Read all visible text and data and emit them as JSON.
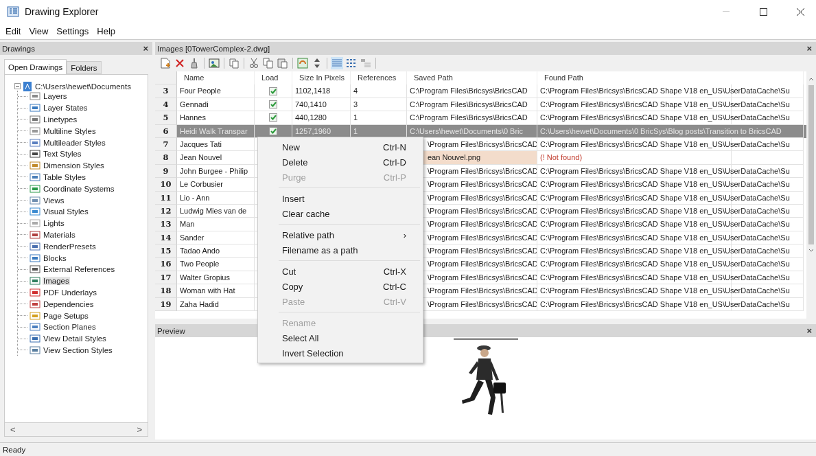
{
  "window": {
    "title": "Drawing Explorer"
  },
  "menubar": [
    "Edit",
    "View",
    "Settings",
    "Help"
  ],
  "drawings_panel": {
    "title": "Drawings",
    "close": "×",
    "tabs": [
      {
        "label": "Open Drawings",
        "selected": true
      },
      {
        "label": "Folders",
        "selected": false
      }
    ],
    "tree": {
      "label": "C:\\Users\\hewet\\Documents",
      "expanded": true,
      "children": [
        {
          "label": "Layers",
          "kind": "layers",
          "selected": false
        },
        {
          "label": "Layer States",
          "kind": "layerstates",
          "selected": false
        },
        {
          "label": "Linetypes",
          "kind": "linetypes",
          "selected": false
        },
        {
          "label": "Multiline Styles",
          "kind": "multiline",
          "selected": false
        },
        {
          "label": "Multileader Styles",
          "kind": "multileader",
          "selected": false
        },
        {
          "label": "Text Styles",
          "kind": "text",
          "selected": false
        },
        {
          "label": "Dimension Styles",
          "kind": "dimension",
          "selected": false
        },
        {
          "label": "Table Styles",
          "kind": "table",
          "selected": false
        },
        {
          "label": "Coordinate Systems",
          "kind": "ucs",
          "selected": false
        },
        {
          "label": "Views",
          "kind": "views",
          "selected": false
        },
        {
          "label": "Visual Styles",
          "kind": "visual",
          "selected": false
        },
        {
          "label": "Lights",
          "kind": "lights",
          "selected": false
        },
        {
          "label": "Materials",
          "kind": "materials",
          "selected": false
        },
        {
          "label": "RenderPresets",
          "kind": "render",
          "selected": false
        },
        {
          "label": "Blocks",
          "kind": "blocks",
          "selected": false
        },
        {
          "label": "External References",
          "kind": "xref",
          "selected": false
        },
        {
          "label": "Images",
          "kind": "images",
          "selected": true
        },
        {
          "label": "PDF Underlays",
          "kind": "pdf",
          "selected": false
        },
        {
          "label": "Dependencies",
          "kind": "deps",
          "selected": false
        },
        {
          "label": "Page Setups",
          "kind": "page",
          "selected": false
        },
        {
          "label": "Section Planes",
          "kind": "section",
          "selected": false
        },
        {
          "label": "View Detail Styles",
          "kind": "detail",
          "selected": false
        },
        {
          "label": "View Section Styles",
          "kind": "viewsection",
          "selected": false
        }
      ]
    },
    "scroll_left": "<",
    "scroll_right": ">"
  },
  "images_panel": {
    "title": "Images [0TowerComplex-2.dwg]",
    "close": "×",
    "toolbar": [
      {
        "kind": "new"
      },
      {
        "kind": "delete"
      },
      {
        "kind": "purge"
      },
      {
        "kind": "separator"
      },
      {
        "kind": "insert"
      },
      {
        "kind": "separator"
      },
      {
        "kind": "reload"
      },
      {
        "kind": "separator"
      },
      {
        "kind": "cut"
      },
      {
        "kind": "copy"
      },
      {
        "kind": "paste"
      },
      {
        "kind": "separator"
      },
      {
        "kind": "refresh"
      },
      {
        "kind": "sort"
      },
      {
        "kind": "separator"
      },
      {
        "kind": "view-details",
        "selected": true
      },
      {
        "kind": "view-icons",
        "selected": false
      },
      {
        "kind": "view-tree",
        "selected": false
      },
      {
        "kind": "separator"
      }
    ],
    "table": {
      "columns": [
        "Name",
        "Load",
        "Size In Pixels",
        "References",
        "Saved Path",
        "Found Path"
      ],
      "rows": [
        {
          "index": "3",
          "name": "Four People",
          "load": true,
          "size": "1102,1418",
          "references": "4",
          "saved_path": "C:\\Program Files\\Bricsys\\BricsCAD",
          "found_path": "C:\\Program Files\\Bricsys\\BricsCAD Shape V18 en_US\\UserDataCache\\Su",
          "selected": false,
          "missing": false
        },
        {
          "index": "4",
          "name": "Gennadi",
          "load": true,
          "size": "740,1410",
          "references": "3",
          "saved_path": "C:\\Program Files\\Bricsys\\BricsCAD",
          "found_path": "C:\\Program Files\\Bricsys\\BricsCAD Shape V18 en_US\\UserDataCache\\Su",
          "selected": false,
          "missing": false
        },
        {
          "index": "5",
          "name": "Hannes",
          "load": true,
          "size": "440,1280",
          "references": "1",
          "saved_path": "C:\\Program Files\\Bricsys\\BricsCAD",
          "found_path": "C:\\Program Files\\Bricsys\\BricsCAD Shape V18 en_US\\UserDataCache\\Su",
          "selected": false,
          "missing": false
        },
        {
          "index": "6",
          "name": "Heidi Walk Transpar",
          "load": true,
          "size": "1257,1960",
          "references": "1",
          "saved_path": "C:\\Users\\hewet\\Documents\\0 Bric",
          "found_path": "C:\\Users\\hewet\\Documents\\0 BricSys\\Blog posts\\Transition to BricsCAD",
          "selected": true,
          "missing": false
        },
        {
          "index": "7",
          "name": "Jacques Tati",
          "saved_path": "\\Program Files\\Bricsys\\BricsCAD",
          "found_path": "C:\\Program Files\\Bricsys\\BricsCAD Shape V18 en_US\\UserDataCache\\Su",
          "selected": false,
          "missing": false
        },
        {
          "index": "8",
          "name": "Jean Nouvel",
          "saved_path": "ean Nouvel.png",
          "found_path": "(! Not found)",
          "selected": false,
          "missing": true
        },
        {
          "index": "9",
          "name": "John Burgee - Philip",
          "saved_path": "\\Program Files\\Bricsys\\BricsCAD",
          "found_path": "C:\\Program Files\\Bricsys\\BricsCAD Shape V18 en_US\\UserDataCache\\Su",
          "selected": false,
          "missing": false
        },
        {
          "index": "10",
          "name": "Le Corbusier",
          "saved_path": "\\Program Files\\Bricsys\\BricsCAD",
          "found_path": "C:\\Program Files\\Bricsys\\BricsCAD Shape V18 en_US\\UserDataCache\\Su",
          "selected": false,
          "missing": false
        },
        {
          "index": "11",
          "name": "Lio - Ann",
          "saved_path": "\\Program Files\\Bricsys\\BricsCAD",
          "found_path": "C:\\Program Files\\Bricsys\\BricsCAD Shape V18 en_US\\UserDataCache\\Su",
          "selected": false,
          "missing": false
        },
        {
          "index": "12",
          "name": "Ludwig Mies van de",
          "saved_path": "\\Program Files\\Bricsys\\BricsCAD",
          "found_path": "C:\\Program Files\\Bricsys\\BricsCAD Shape V18 en_US\\UserDataCache\\Su",
          "selected": false,
          "missing": false
        },
        {
          "index": "13",
          "name": "Man",
          "saved_path": "\\Program Files\\Bricsys\\BricsCAD",
          "found_path": "C:\\Program Files\\Bricsys\\BricsCAD Shape V18 en_US\\UserDataCache\\Su",
          "selected": false,
          "missing": false
        },
        {
          "index": "14",
          "name": "Sander",
          "saved_path": "\\Program Files\\Bricsys\\BricsCAD",
          "found_path": "C:\\Program Files\\Bricsys\\BricsCAD Shape V18 en_US\\UserDataCache\\Su",
          "selected": false,
          "missing": false
        },
        {
          "index": "15",
          "name": "Tadao Ando",
          "saved_path": "\\Program Files\\Bricsys\\BricsCAD",
          "found_path": "C:\\Program Files\\Bricsys\\BricsCAD Shape V18 en_US\\UserDataCache\\Su",
          "selected": false,
          "missing": false
        },
        {
          "index": "16",
          "name": "Two People",
          "saved_path": "\\Program Files\\Bricsys\\BricsCAD",
          "found_path": "C:\\Program Files\\Bricsys\\BricsCAD Shape V18 en_US\\UserDataCache\\Su",
          "selected": false,
          "missing": false
        },
        {
          "index": "17",
          "name": "Walter Gropius",
          "saved_path": "\\Program Files\\Bricsys\\BricsCAD",
          "found_path": "C:\\Program Files\\Bricsys\\BricsCAD Shape V18 en_US\\UserDataCache\\Su",
          "selected": false,
          "missing": false
        },
        {
          "index": "18",
          "name": "Woman with Hat",
          "saved_path": "\\Program Files\\Bricsys\\BricsCAD",
          "found_path": "C:\\Program Files\\Bricsys\\BricsCAD Shape V18 en_US\\UserDataCache\\Su",
          "selected": false,
          "missing": false
        },
        {
          "index": "19",
          "name": "Zaha Hadid",
          "saved_path": "\\Program Files\\Bricsys\\BricsCAD",
          "found_path": "C:\\Program Files\\Bricsys\\BricsCAD Shape V18 en_US\\UserDataCache\\Su",
          "selected": false,
          "missing": false
        }
      ]
    },
    "context_menu": [
      {
        "kind": "item",
        "label": "New",
        "shortcut": "Ctrl-N",
        "disabled": false
      },
      {
        "kind": "item",
        "label": "Delete",
        "shortcut": "Ctrl-D",
        "disabled": false
      },
      {
        "kind": "item",
        "label": "Purge",
        "shortcut": "Ctrl-P",
        "disabled": true
      },
      {
        "kind": "separator"
      },
      {
        "kind": "item",
        "label": "Insert",
        "disabled": false
      },
      {
        "kind": "item",
        "label": "Clear cache",
        "disabled": false
      },
      {
        "kind": "separator"
      },
      {
        "kind": "submenu",
        "label": "Relative path",
        "arrow": "›",
        "disabled": false
      },
      {
        "kind": "item",
        "label": "Filename as a path",
        "disabled": false
      },
      {
        "kind": "separator"
      },
      {
        "kind": "item",
        "label": "Cut",
        "shortcut": "Ctrl-X",
        "disabled": false
      },
      {
        "kind": "item",
        "label": "Copy",
        "shortcut": "Ctrl-C",
        "disabled": false
      },
      {
        "kind": "item",
        "label": "Paste",
        "shortcut": "Ctrl-V",
        "disabled": true
      },
      {
        "kind": "separator"
      },
      {
        "kind": "item",
        "label": "Rename",
        "disabled": true
      },
      {
        "kind": "item",
        "label": "Select All",
        "disabled": false
      },
      {
        "kind": "item",
        "label": "Invert Selection",
        "disabled": false
      }
    ]
  },
  "preview_panel": {
    "title": "Preview",
    "close": "×"
  },
  "status_bar": "Ready"
}
